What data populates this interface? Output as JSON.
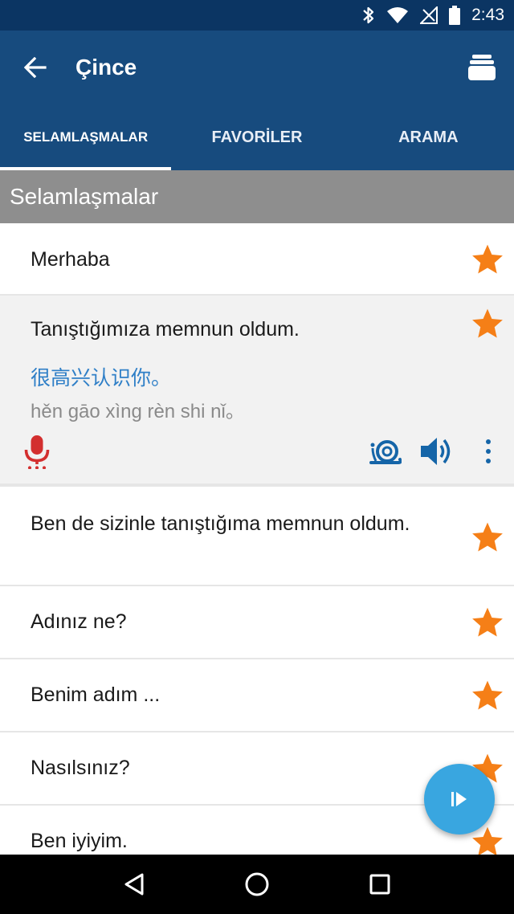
{
  "status_bar": {
    "time": "2:43",
    "icons": [
      "bluetooth-icon",
      "wifi-icon",
      "no-sim-icon",
      "battery-icon"
    ]
  },
  "app_bar": {
    "title": "Çince",
    "back_icon": "arrow-left-icon",
    "menu_icon": "stack-icon"
  },
  "tabs": [
    {
      "label": "SELAMLAŞMALAR",
      "selected": true
    },
    {
      "label": "FAVORİLER",
      "selected": false
    },
    {
      "label": "ARAMA",
      "selected": false
    }
  ],
  "section_header": "Selamlaşmalar",
  "phrases": [
    {
      "text": "Merhaba",
      "favorite": true
    },
    {
      "text": "Tanıştığımıza memnun oldum.",
      "chinese": "很高兴认识你。",
      "pinyin": "hěn gāo xìng rèn shi nǐ。",
      "favorite": true,
      "expanded": true
    },
    {
      "text": "Ben de sizinle tanıştığıma memnun oldum.",
      "favorite": true
    },
    {
      "text": "Adınız ne?",
      "favorite": true
    },
    {
      "text": "Benim adım ...",
      "favorite": true
    },
    {
      "text": "Nasılsınız?",
      "favorite": true
    },
    {
      "text": "Ben iyiyim.",
      "favorite": true
    }
  ],
  "colors": {
    "app_bar": "#174b7e",
    "status_bar": "#0b3563",
    "section_header": "#8e8e8e",
    "star": "#f57f17",
    "chinese_text": "#2f7fc7",
    "mic": "#d32f2f",
    "action_blue": "#1565a8",
    "fab": "#39a6e0"
  }
}
